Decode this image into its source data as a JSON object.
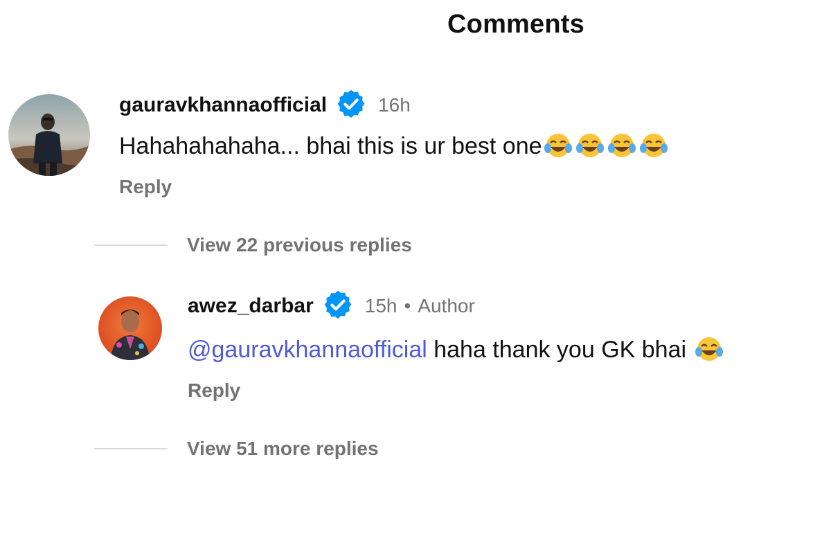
{
  "header": {
    "title": "Comments"
  },
  "comments": [
    {
      "username": "gauravkhannaofficial",
      "verified": true,
      "time": "16h",
      "text": "Hahahahahaha... bhai this is ur best one",
      "emoji": "face-with-tears-of-joy",
      "emoji_count": 4,
      "reply_label": "Reply",
      "view_replies_label": "View 22 previous replies"
    },
    {
      "username": "awez_darbar",
      "verified": true,
      "time": "15h",
      "separator": "•",
      "author_label": "Author",
      "mention": "@gauravkhannaofficial",
      "text": " haha thank you GK bhai ",
      "emoji": "face-with-tears-of-joy",
      "emoji_count": 1,
      "reply_label": "Reply",
      "view_replies_label": "View 51 more replies"
    }
  ],
  "colors": {
    "mention": "#4f5bd5",
    "verified_badge": "#0095f6",
    "muted_text": "#737373"
  }
}
